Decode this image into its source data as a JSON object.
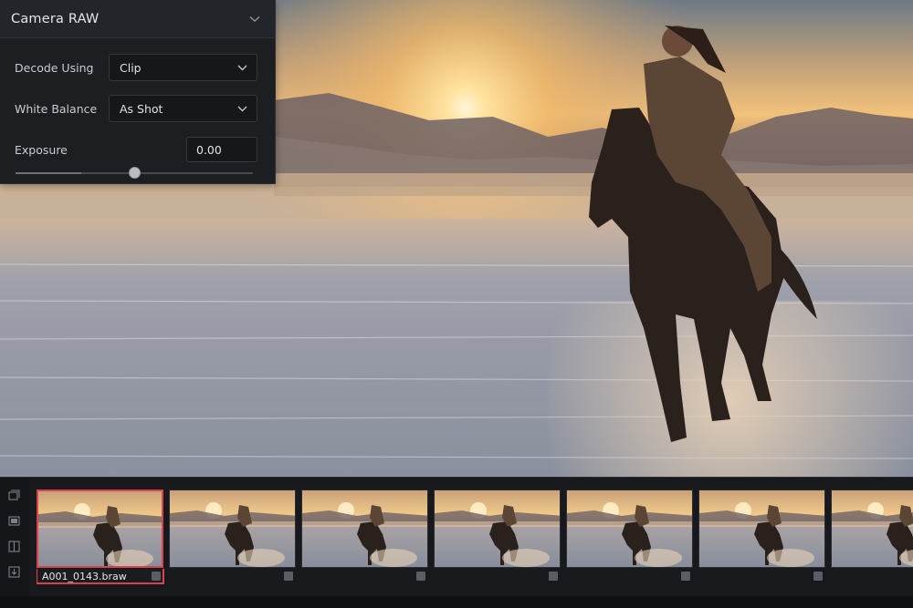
{
  "raw_panel": {
    "title": "Camera RAW",
    "decode_using": {
      "label": "Decode Using",
      "value": "Clip"
    },
    "white_balance": {
      "label": "White Balance",
      "value": "As Shot"
    },
    "exposure": {
      "label": "Exposure",
      "value": "0.00",
      "slider_fraction": 0.5
    }
  },
  "clips": {
    "selected_index": 0,
    "items": [
      {
        "name": "A001_0143.braw"
      },
      {
        "name": ""
      },
      {
        "name": ""
      },
      {
        "name": ""
      },
      {
        "name": ""
      },
      {
        "name": ""
      },
      {
        "name": ""
      }
    ]
  },
  "icons": {
    "collapse": "chevron-down-icon",
    "dropdown": "chevron-down-icon",
    "tools": [
      "clips-icon",
      "viewer-icon",
      "split-icon",
      "export-icon"
    ]
  },
  "colors": {
    "selection": "#d9434c",
    "panel": "#1c1e22"
  }
}
